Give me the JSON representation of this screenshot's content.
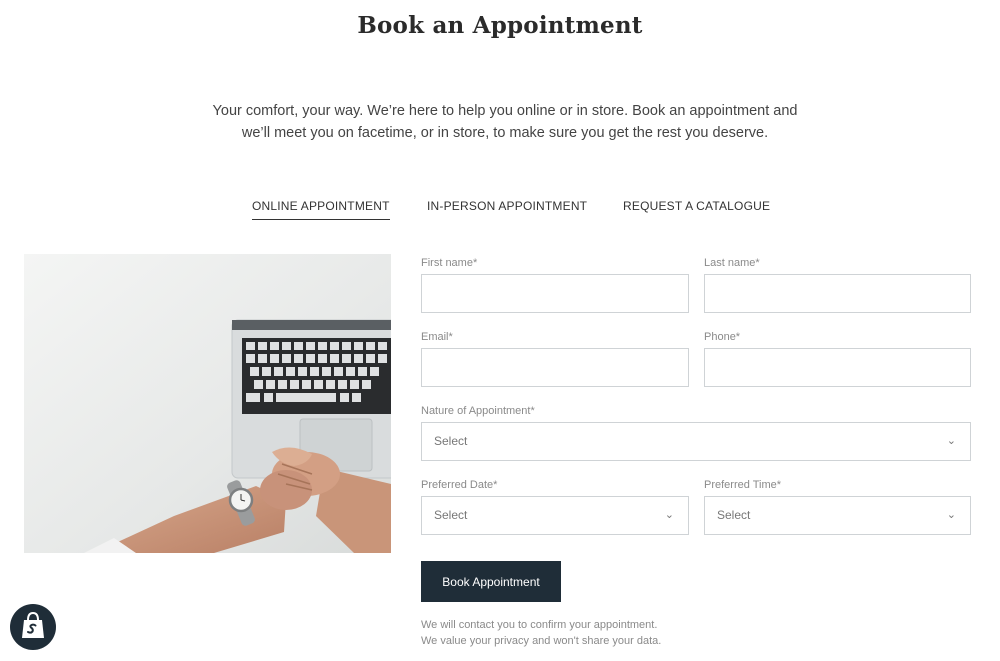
{
  "page": {
    "title": "Book an Appointment",
    "intro_line1": "Your comfort, your way. We’re here to help you online or in store. Book an appointment and",
    "intro_line2": "we’ll meet you on facetime, or in store, to make sure you get the rest you deserve."
  },
  "tabs": [
    {
      "label": "ONLINE APPOINTMENT",
      "active": true
    },
    {
      "label": "IN-PERSON APPOINTMENT",
      "active": false
    },
    {
      "label": "REQUEST A CATALOGUE",
      "active": false
    }
  ],
  "form": {
    "first_name": {
      "label": "First name*",
      "value": ""
    },
    "last_name": {
      "label": "Last name*",
      "value": ""
    },
    "email": {
      "label": "Email*",
      "value": ""
    },
    "phone": {
      "label": "Phone*",
      "value": ""
    },
    "nature": {
      "label": "Nature of Appointment*",
      "value": "Select"
    },
    "date": {
      "label": "Preferred Date*",
      "value": "Select"
    },
    "time": {
      "label": "Preferred Time*",
      "value": "Select"
    },
    "submit_label": "Book Appointment",
    "note_line1": "We will contact you to confirm your appointment.",
    "note_line2": "We value your privacy and won't share your data."
  },
  "icons": {
    "select_chevron": "chevron-down-icon",
    "badge": "shopify-bag-icon"
  },
  "colors": {
    "button_bg": "#1f2d38",
    "border": "#cfd3d6",
    "label": "#8a8a8a"
  }
}
